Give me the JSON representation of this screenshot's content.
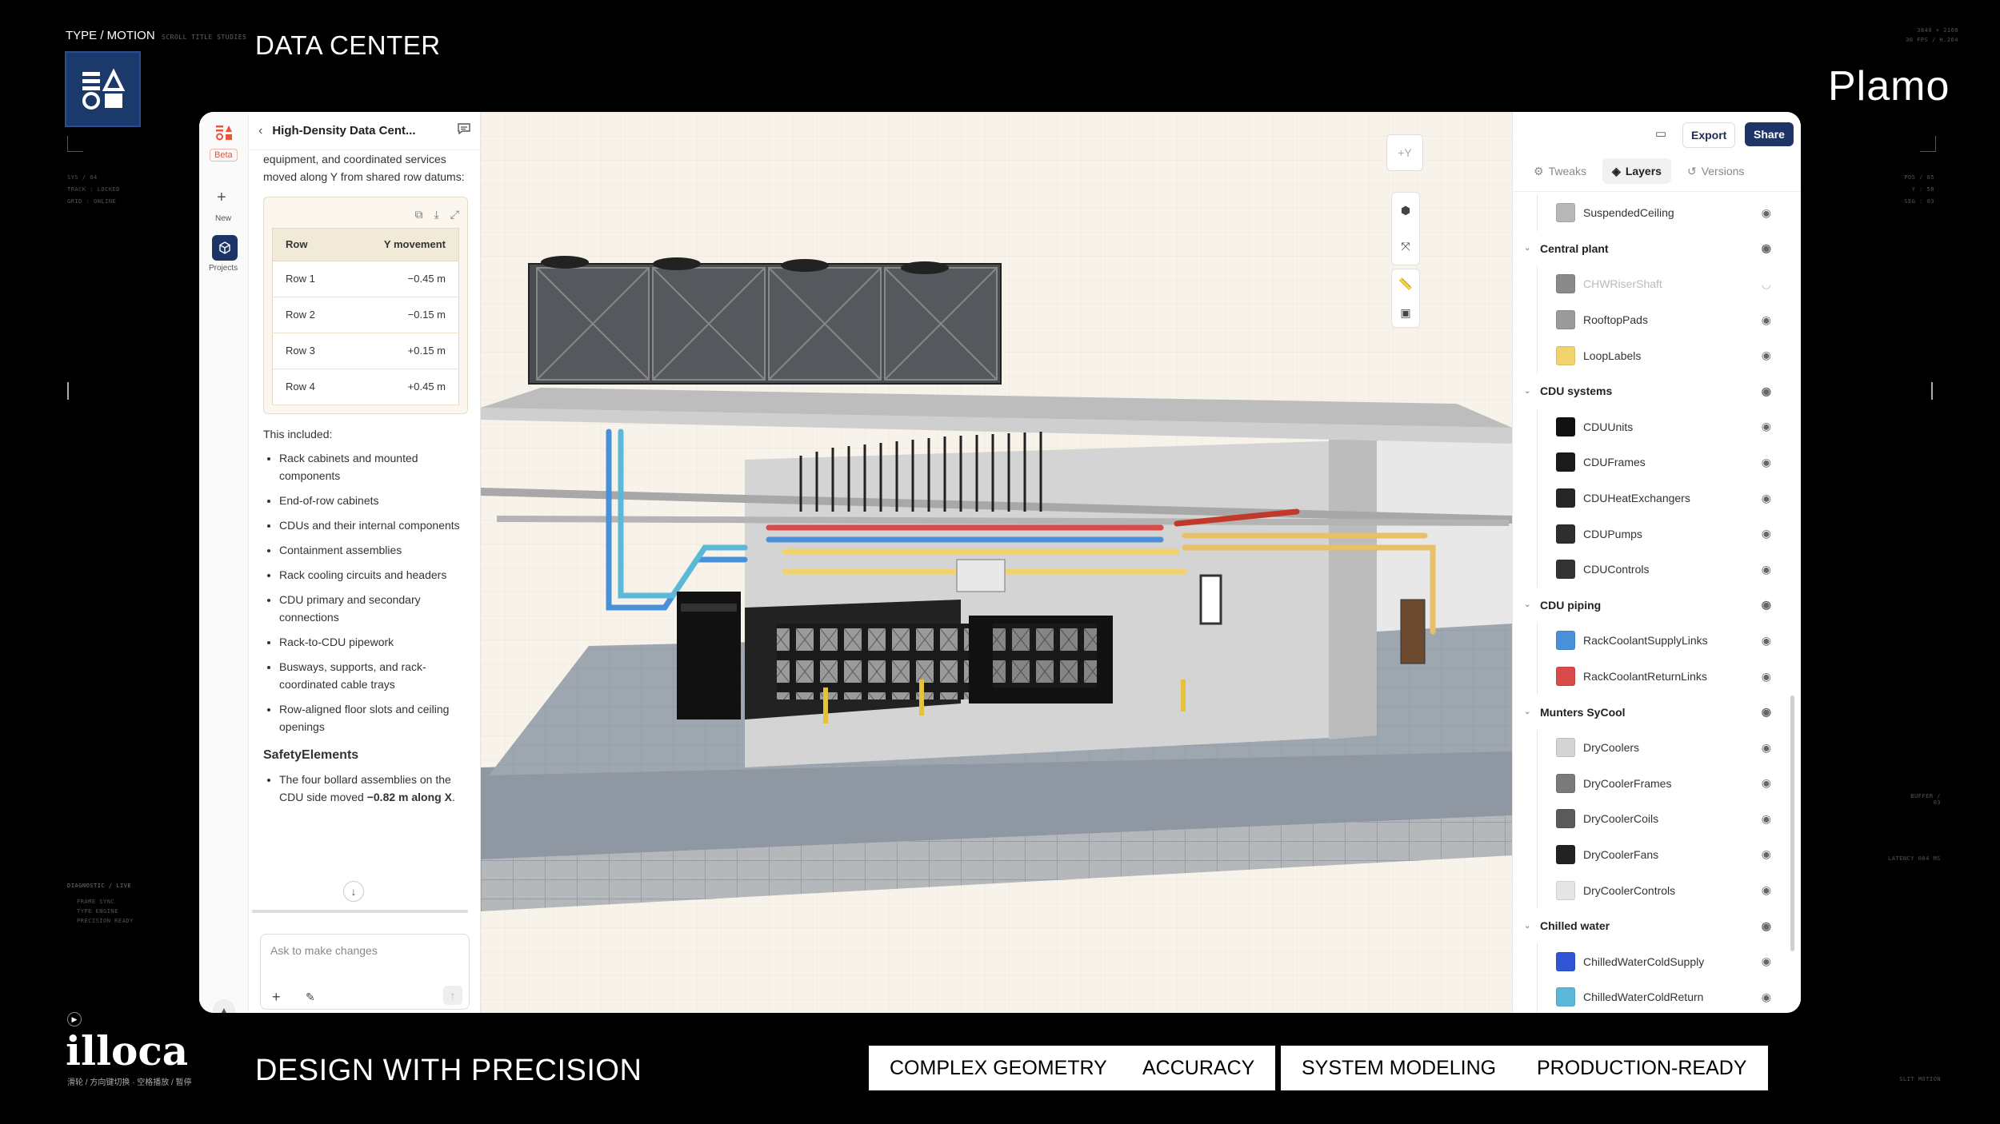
{
  "frame": {
    "brand": "TYPE / MOTION",
    "brand_sub": "SCROLL TITLE STUDIES",
    "title": "DATA CENTER",
    "right_logo": "Plamo",
    "top_right_meta_1": "3840 × 2160",
    "top_right_meta_2": "30 FPS / H.264",
    "left_meta_1": "SYS / 04",
    "left_meta_2": "TRACK : LOCKED",
    "left_meta_3": "GRID : ONLINE",
    "right_meta_1": "POS / 05",
    "right_meta_2": "Y : 58",
    "right_meta_3": "SEG : 03",
    "diag_title": "DIAGNOSTIC / LIVE",
    "diag_items": [
      "FRAME SYNC",
      "TYPE ENGINE",
      "PRECISION READY"
    ],
    "buffer": "BUFFER / 03",
    "latency": "LATENCY 004 MS",
    "slit_motion": "SLIT MOTION",
    "illoca": "illoca",
    "illoca_sub": "滑轮 / 方向键切换 · 空格播放 / 暂停",
    "tagline": "DESIGN WITH PRECISION",
    "pills": [
      "COMPLEX GEOMETRY",
      "ACCURACY",
      "SYSTEM MODELING",
      "PRODUCTION-READY"
    ]
  },
  "rail": {
    "beta": "Beta",
    "new_label": "New",
    "projects_label": "Projects"
  },
  "chat": {
    "title": "High-Density Data Cent...",
    "intro": "equipment, and coordinated services moved along Y from shared row datums:",
    "table": {
      "headers": [
        "Row",
        "Y movement"
      ],
      "rows": [
        {
          "row": "Row 1",
          "move": "−0.45 m"
        },
        {
          "row": "Row 2",
          "move": "−0.15 m"
        },
        {
          "row": "Row 3",
          "move": "+0.15 m"
        },
        {
          "row": "Row 4",
          "move": "+0.45 m"
        }
      ]
    },
    "included_label": "This included:",
    "included": [
      "Rack cabinets and mounted components",
      "End-of-row cabinets",
      "CDUs and their internal components",
      "Containment assemblies",
      "Rack cooling circuits and headers",
      "CDU primary and secondary connections",
      "Rack-to-CDU pipework",
      "Busways, supports, and rack-coordinated cable trays",
      "Row-aligned floor slots and ceiling openings"
    ],
    "safety_title": "SafetyElements",
    "safety_text_1": "The four bollard assemblies on the CDU side moved",
    "safety_text_bold": "−0.82 m along X",
    "safety_text_2": ".",
    "input_placeholder": "Ask to make changes"
  },
  "viewport": {
    "axis_label": "+Y"
  },
  "panel": {
    "export": "Export",
    "share": "Share",
    "tabs": [
      "Tweaks",
      "Layers",
      "Versions"
    ],
    "active_tab": "Layers",
    "layers": [
      {
        "type": "item",
        "name": "SuspendedCeiling",
        "color": "#b8b8b8"
      },
      {
        "type": "group",
        "name": "Central plant"
      },
      {
        "type": "item",
        "name": "CHWRiserShaft",
        "color": "#8a8a8a",
        "hidden": true
      },
      {
        "type": "item",
        "name": "RooftopPads",
        "color": "#9a9a9a"
      },
      {
        "type": "item",
        "name": "LoopLabels",
        "color": "#f2d36b"
      },
      {
        "type": "group",
        "name": "CDU systems"
      },
      {
        "type": "item",
        "name": "CDUUnits",
        "color": "#111111"
      },
      {
        "type": "item",
        "name": "CDUFrames",
        "color": "#1a1a1a"
      },
      {
        "type": "item",
        "name": "CDUHeatExchangers",
        "color": "#262626"
      },
      {
        "type": "item",
        "name": "CDUPumps",
        "color": "#2e2e2e"
      },
      {
        "type": "item",
        "name": "CDUControls",
        "color": "#333333"
      },
      {
        "type": "group",
        "name": "CDU piping"
      },
      {
        "type": "item",
        "name": "RackCoolantSupplyLinks",
        "color": "#4a90d9"
      },
      {
        "type": "item",
        "name": "RackCoolantReturnLinks",
        "color": "#d94a4a"
      },
      {
        "type": "group",
        "name": "Munters SyCool"
      },
      {
        "type": "item",
        "name": "DryCoolers",
        "color": "#d4d4d4"
      },
      {
        "type": "item",
        "name": "DryCoolerFrames",
        "color": "#7a7a7a"
      },
      {
        "type": "item",
        "name": "DryCoolerCoils",
        "color": "#5a5a5a"
      },
      {
        "type": "item",
        "name": "DryCoolerFans",
        "color": "#222222"
      },
      {
        "type": "item",
        "name": "DryCoolerControls",
        "color": "#e6e6e6"
      },
      {
        "type": "group",
        "name": "Chilled water"
      },
      {
        "type": "item",
        "name": "ChilledWaterColdSupply",
        "color": "#2f55d4"
      },
      {
        "type": "item",
        "name": "ChilledWaterColdReturn",
        "color": "#5bb8d8"
      }
    ]
  }
}
